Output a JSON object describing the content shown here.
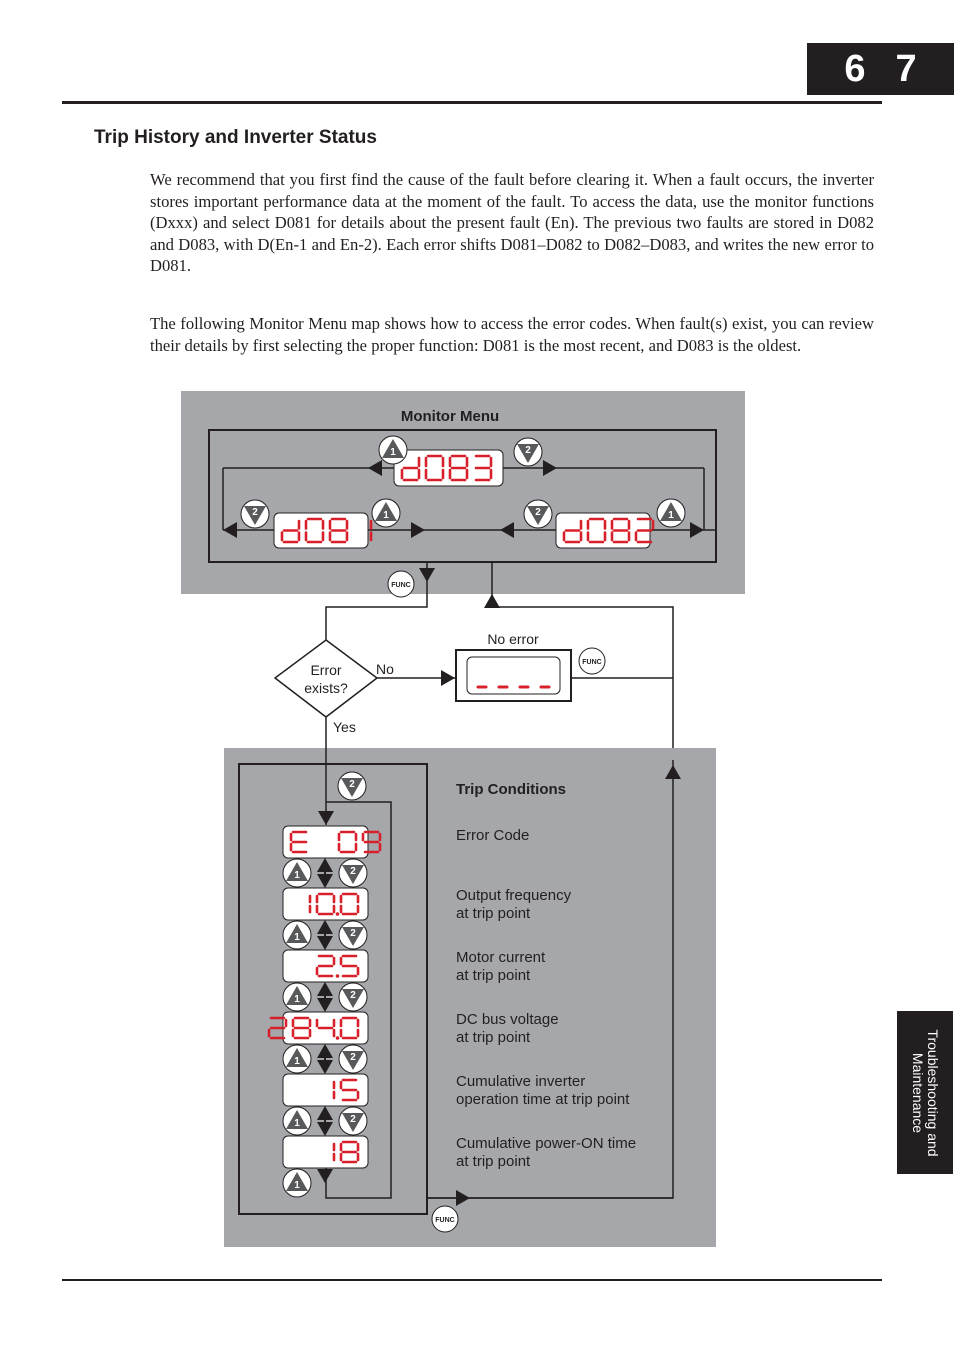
{
  "page": {
    "chapter_tab": [
      "6",
      "7"
    ],
    "side_tab": [
      "Troubleshooting and",
      "Maintenance"
    ]
  },
  "section": {
    "title": "Trip History and Inverter Status",
    "paragraphs": [
      "We recommend that you first find the cause of the fault before clearing it. When a fault occurs, the inverter stores important performance data at the moment of the fault. To access the data, use the monitor functions (Dxxx) and select D081 for details about the present fault (En). The previous two faults are stored in D082 and D083, with D(En-1 and En-2). Each error shifts D081–D082 to D082–D083, and writes the new error to D081.",
      "The following Monitor Menu map shows how to access the error codes. When fault(s) exist, you can review their details by first selecting the proper function: D081 is the most recent, and D083 is the oldest."
    ]
  },
  "diagram": {
    "monitor_menu": {
      "title": "Monitor Menu",
      "displays": {
        "top": "d083",
        "left": "d081",
        "right": "d082"
      }
    },
    "decision": {
      "line1": "Error",
      "line2": "exists?",
      "no_label": "No",
      "yes_label": "Yes"
    },
    "no_error": {
      "label": "No error",
      "display": "----"
    },
    "func_label": "FUNC",
    "key_up_label": "1",
    "key_down_label": "2",
    "trip_conditions": {
      "title": "Trip Conditions",
      "rows": [
        {
          "display": "E 09",
          "desc": [
            "Error Code"
          ]
        },
        {
          "display": "10.0",
          "desc": [
            "Output frequency",
            "at trip point"
          ]
        },
        {
          "display": "2.5",
          "desc": [
            "Motor current",
            "at trip point"
          ]
        },
        {
          "display": "284.0",
          "desc": [
            "DC bus voltage",
            "at trip point"
          ]
        },
        {
          "display": "15",
          "desc": [
            "Cumulative inverter",
            "operation time at trip point"
          ]
        },
        {
          "display": "18",
          "desc": [
            "Cumulative power-ON time",
            "at trip point"
          ]
        }
      ]
    },
    "colors": {
      "panel_gray": "#a5a7aa",
      "segment_red": "#d7202a",
      "key_gray": "#58595b",
      "line": "#231f20"
    }
  }
}
